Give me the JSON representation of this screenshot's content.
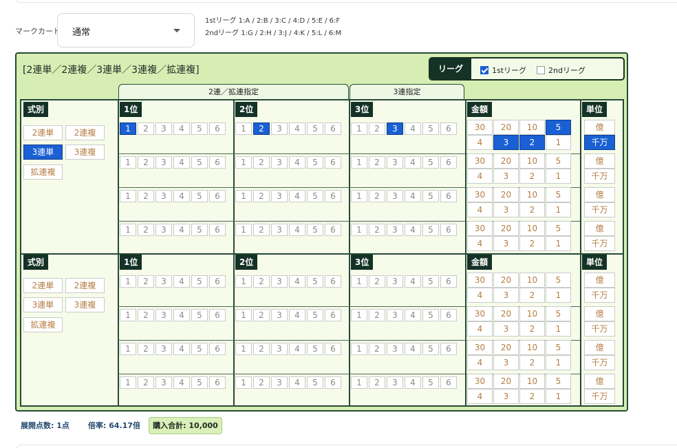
{
  "mark_card": {
    "label": "マークカード",
    "select_value": "通常",
    "league_map_1": "1stリーグ  1:A / 2:B / 3:C / 4:D / 5:E / 6:F",
    "league_map_2": "2ndリーグ  1:G / 2:H / 3:J / 4:K / 5:L / 6:M"
  },
  "card": {
    "title": "[2連単／2連複／3連単／3連複／拡連複]",
    "league": {
      "header": "リーグ",
      "options": [
        {
          "label": "1stリーグ",
          "checked": true
        },
        {
          "label": "2ndリーグ",
          "checked": false
        }
      ]
    },
    "tab_two": "2連／拡連指定",
    "tab_three": "3連指定",
    "headers": {
      "type": "式別",
      "first": "1位",
      "second": "2位",
      "third": "3位",
      "amount": "金額",
      "unit": "単位"
    },
    "bet_type_labels": [
      "2連単",
      "2連複",
      "3連単",
      "3連複",
      "拡連複"
    ],
    "amount_labels_top": [
      "30",
      "20",
      "10",
      "5"
    ],
    "amount_labels_bottom": [
      "4",
      "3",
      "2",
      "1"
    ],
    "unit_labels": [
      "億",
      "千万"
    ],
    "blocks": [
      {
        "bet_type_selected": "3連単",
        "rows": [
          {
            "first": 1,
            "second": 2,
            "third": 3,
            "amount": [
              "5",
              "3",
              "2"
            ],
            "unit": "千万"
          },
          {
            "first": null,
            "second": null,
            "third": null,
            "amount": [],
            "unit": null
          },
          {
            "first": null,
            "second": null,
            "third": null,
            "amount": [],
            "unit": null
          },
          {
            "first": null,
            "second": null,
            "third": null,
            "amount": [],
            "unit": null
          }
        ]
      },
      {
        "bet_type_selected": null,
        "rows": [
          {
            "first": null,
            "second": null,
            "third": null,
            "amount": [],
            "unit": null
          },
          {
            "first": null,
            "second": null,
            "third": null,
            "amount": [],
            "unit": null
          },
          {
            "first": null,
            "second": null,
            "third": null,
            "amount": [],
            "unit": null
          },
          {
            "first": null,
            "second": null,
            "third": null,
            "amount": [],
            "unit": null
          }
        ]
      }
    ]
  },
  "summary": {
    "points": "展開点数: 1点",
    "odds": "倍率: 64.17倍",
    "total": "購入合計: 10,000"
  },
  "colors": {
    "card_bg": "#d6eeb4",
    "dark_green": "#143226",
    "selected_blue": "#1a60d4",
    "label_orange": "#b47c43"
  }
}
